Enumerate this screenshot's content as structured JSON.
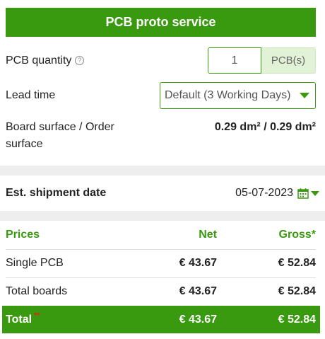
{
  "header": {
    "title": "PCB proto service"
  },
  "quantity": {
    "label": "PCB quantity",
    "value": "1",
    "unit": "PCB(s)"
  },
  "lead_time": {
    "label": "Lead time",
    "selected": "Default (3 Working Days)"
  },
  "surface": {
    "label_line1": "Board surface / Order",
    "label_line2": "surface",
    "value": "0.29 dm² / 0.29 dm²"
  },
  "shipment": {
    "label": "Est. shipment date",
    "date": "05-07-2023"
  },
  "prices": {
    "headers": {
      "label": "Prices",
      "net": "Net",
      "gross": "Gross*"
    },
    "rows": [
      {
        "label": "Single PCB",
        "net": "€ 43.67",
        "gross": "€ 52.84"
      },
      {
        "label": "Total boards",
        "net": "€ 43.67",
        "gross": "€ 52.84"
      }
    ],
    "total": {
      "label": "Total",
      "stars": "**",
      "net": "€ 43.67",
      "gross": "€ 52.84"
    }
  },
  "colors": {
    "accent": "#3a9a0f",
    "band": "#eeeeee",
    "star": "#e0221b"
  },
  "icons": {
    "help": "question-circle-icon",
    "calendar": "calendar-icon",
    "caret": "caret-down-icon"
  }
}
